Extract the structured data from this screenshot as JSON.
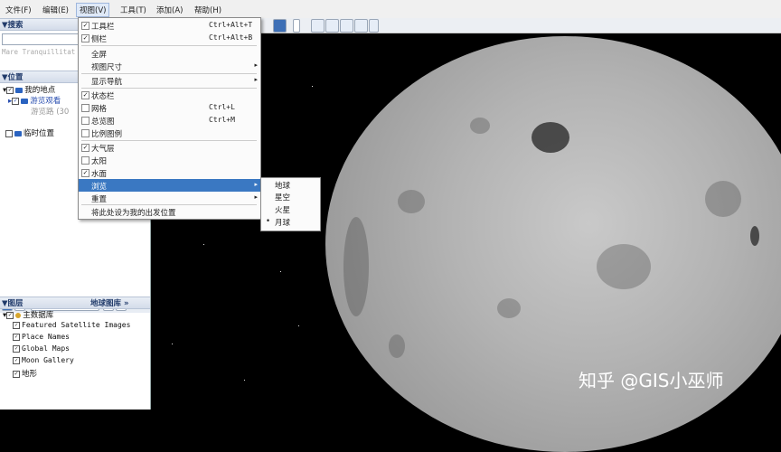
{
  "menubar": {
    "items": [
      "文件(F)",
      "编辑(E)",
      "视图(V)",
      "工具(T)",
      "添加(A)",
      "帮助(H)"
    ]
  },
  "sidebar": {
    "search_title": "▼搜索",
    "search_hint": "Mare Tranquillitat",
    "places_title": "▼位置",
    "my_places": "我的地点",
    "sightseeing": "游览观看",
    "sightseeing_sub": "游览路 (30",
    "temp_places": "临时位置",
    "layers_title": "▼图层",
    "layers_gallery": "地球图库 »",
    "layers_root": "主数据库",
    "layers_items": [
      "Featured Satellite Images",
      "Place Names",
      "Global Maps",
      "Moon Gallery",
      "地形"
    ]
  },
  "view_menu": {
    "items": [
      {
        "label": "工具栏",
        "shortcut": "Ctrl+Alt+T",
        "checked": true
      },
      {
        "label": "侧栏",
        "shortcut": "Ctrl+Alt+B",
        "checked": true
      },
      {
        "label": "全屏",
        "shortcut": ""
      },
      {
        "label": "视图尺寸",
        "arrow": "▸"
      },
      {
        "label": "显示导航",
        "arrow": "▸"
      },
      {
        "label": "状态栏",
        "checked": true
      },
      {
        "label": "网格",
        "shortcut": "Ctrl+L",
        "checked": false
      },
      {
        "label": "总览图",
        "shortcut": "Ctrl+M",
        "checked": false
      },
      {
        "label": "比例图例",
        "checked": false
      },
      {
        "label": "大气层",
        "checked": true
      },
      {
        "label": "太阳",
        "checked": false
      },
      {
        "label": "水面",
        "checked": true
      },
      {
        "label": "浏览",
        "arrow": "▸"
      },
      {
        "label": "重置",
        "arrow": "▸"
      },
      {
        "label": "将此处设为我的出发位置"
      }
    ]
  },
  "sub_menu": {
    "items": [
      "地球",
      "星空",
      "火星",
      "月球"
    ],
    "selected_marker": "•"
  },
  "watermark": "知乎 @GIS小巫师",
  "colors": {
    "menu_highlight": "#3a78c2",
    "panel_header": "#203a6a"
  }
}
